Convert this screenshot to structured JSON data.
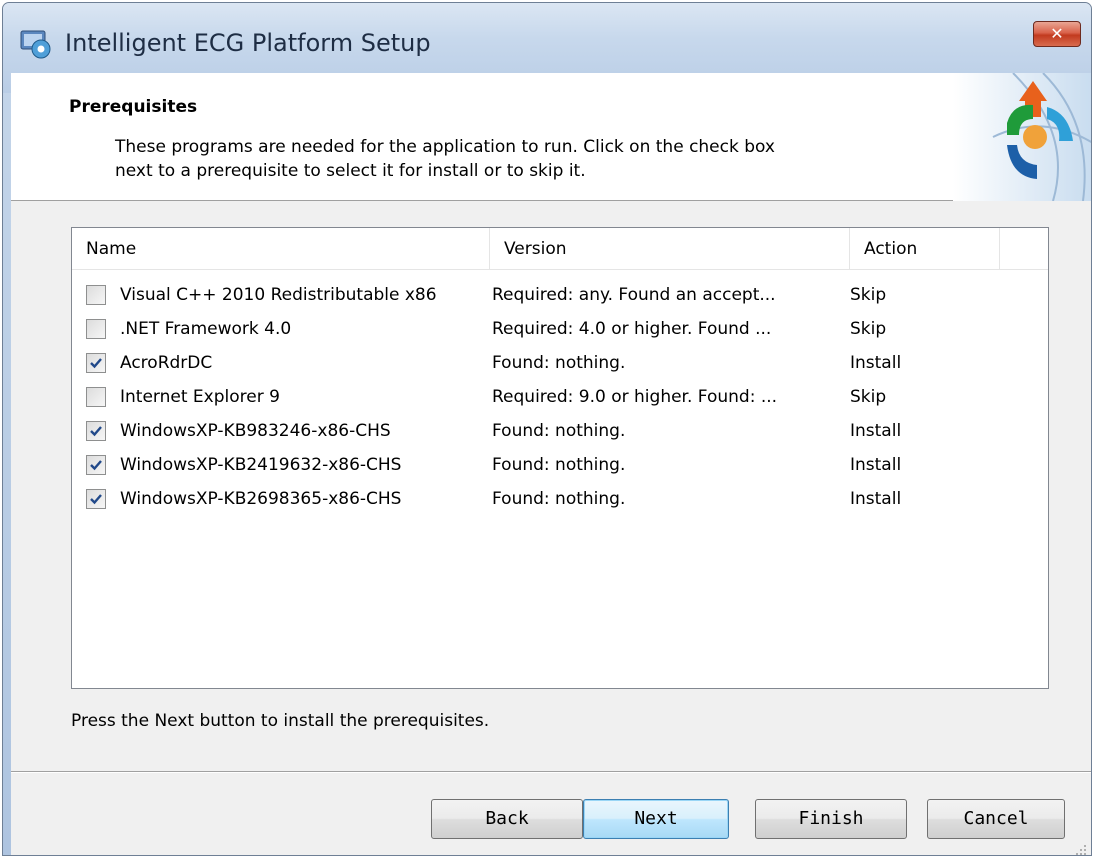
{
  "window": {
    "title": "Intelligent ECG Platform Setup",
    "close_label": "✕"
  },
  "header": {
    "title": "Prerequisites",
    "description_line1": "These programs are needed for the application to run. Click on the check box",
    "description_line2": "next to a prerequisite to select it for install or to skip it."
  },
  "grid": {
    "columns": [
      "Name",
      "Version",
      "Action"
    ],
    "rows": [
      {
        "checked": false,
        "name": "Visual C++ 2010 Redistributable x86",
        "version": "Required: any. Found an accept...",
        "action": "Skip"
      },
      {
        "checked": false,
        "name": ".NET Framework 4.0",
        "version": "Required: 4.0 or higher. Found ...",
        "action": "Skip"
      },
      {
        "checked": true,
        "name": "AcroRdrDC",
        "version": " Found: nothing.",
        "action": "Install"
      },
      {
        "checked": false,
        "name": "Internet Explorer 9",
        "version": "Required: 9.0 or higher. Found: ...",
        "action": "Skip"
      },
      {
        "checked": true,
        "name": "WindowsXP-KB983246-x86-CHS",
        "version": " Found: nothing.",
        "action": "Install"
      },
      {
        "checked": true,
        "name": "WindowsXP-KB2419632-x86-CHS",
        "version": " Found: nothing.",
        "action": "Install"
      },
      {
        "checked": true,
        "name": "WindowsXP-KB2698365-x86-CHS",
        "version": " Found: nothing.",
        "action": "Install"
      }
    ]
  },
  "note": "Press the Next button to install the prerequisites.",
  "buttons": {
    "back": "Back",
    "next": "Next",
    "finish": "Finish",
    "cancel": "Cancel"
  },
  "colors": {
    "accent": "#3c7fb1",
    "close": "#c23a1f"
  }
}
